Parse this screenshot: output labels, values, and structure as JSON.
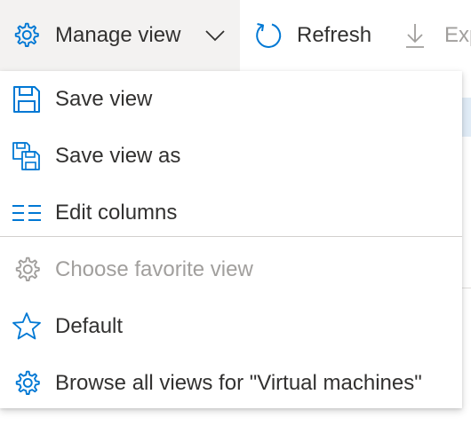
{
  "toolbar": {
    "manage_view": {
      "label": "Manage view",
      "icon": "gear-icon",
      "caret": "chevron-down-icon"
    },
    "refresh": {
      "label": "Refresh",
      "icon": "refresh-icon"
    },
    "export": {
      "label": "Exp",
      "icon": "download-icon"
    }
  },
  "menu": {
    "items": [
      {
        "label": "Save view",
        "icon": "save-icon",
        "enabled": true
      },
      {
        "label": "Save view as",
        "icon": "save-as-icon",
        "enabled": true
      },
      {
        "label": "Edit columns",
        "icon": "columns-icon",
        "enabled": true
      },
      {
        "label": "Choose favorite view",
        "icon": "gear-icon",
        "enabled": false
      },
      {
        "label": "Default",
        "icon": "star-icon",
        "enabled": true
      },
      {
        "label": "Browse all views for \"Virtual machines\"",
        "icon": "gear-icon",
        "enabled": true
      }
    ]
  },
  "colors": {
    "accent": "#0078d4",
    "text": "#323130",
    "disabled": "#a19f9d",
    "toolbar_active_bg": "#f3f2f1"
  }
}
